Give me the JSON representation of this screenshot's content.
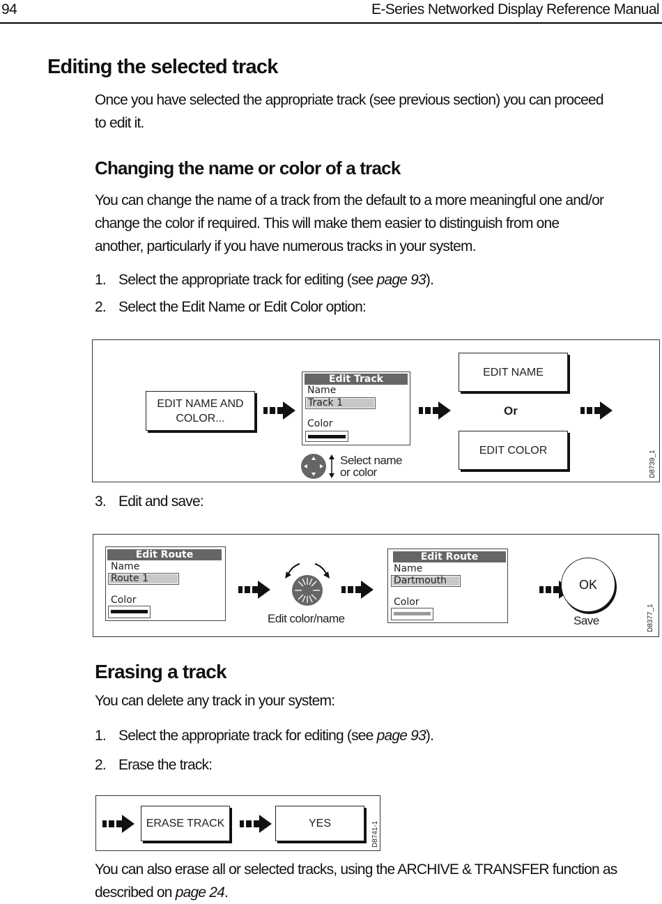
{
  "header": {
    "page_number": "94",
    "manual_title": "E-Series Networked Display Reference Manual"
  },
  "section_editing": {
    "heading": "Editing the selected track",
    "intro_line1": "Once you have selected the appropriate track (see previous section) you can proceed",
    "intro_line2": "to edit it."
  },
  "section_change": {
    "heading": "Changing the name or color of a track",
    "para_line1": "You can change the name of a track from the default to a more meaningful one and/or",
    "para_line2": "change the color if required. This will make them easier to distinguish from one",
    "para_line3": "another, particularly if you have numerous tracks in your system.",
    "steps": [
      {
        "num": "1.",
        "text": "Select the appropriate track for editing (see ",
        "link": "page 93",
        "after": ")."
      },
      {
        "num": "2.",
        "text": "Select the Edit Name or Edit Color option:"
      },
      {
        "num": "3.",
        "text": "Edit and save:"
      }
    ]
  },
  "diagram1": {
    "softkey_edit_name_color_line1": "EDIT NAME AND",
    "softkey_edit_name_color_line2": "COLOR...",
    "dialog": {
      "title": "Edit Track",
      "name_label": "Name",
      "name_value": "Track 1",
      "color_label": "Color",
      "color_swatch": "#111111"
    },
    "trackpad_caption_line1": "Select name",
    "trackpad_caption_line2": "or color",
    "softkey_edit_name": "EDIT NAME",
    "or_label": "Or",
    "softkey_edit_color": "EDIT COLOR",
    "diagram_id": "D8739_1"
  },
  "diagram2": {
    "dialog_before": {
      "title": "Edit Route",
      "name_label": "Name",
      "name_value": "Route 1",
      "color_label": "Color",
      "color_swatch": "#111111"
    },
    "knob_caption": "Edit color/name",
    "dialog_after": {
      "title": "Edit Route",
      "name_label": "Name",
      "name_value": "Dartmouth",
      "color_label": "Color",
      "color_swatch": "#999999"
    },
    "ok_button": "OK",
    "ok_caption": "Save",
    "diagram_id": "D8377_1"
  },
  "section_erase": {
    "heading": "Erasing a track",
    "intro": "You can delete any track in your system:",
    "steps": [
      {
        "num": "1.",
        "text": "Select the appropriate track for editing (see ",
        "link": "page 93",
        "after": ")."
      },
      {
        "num": "2.",
        "text": "Erase the track:"
      }
    ],
    "closing_line1": "You can also erase all or selected tracks, using the ARCHIVE & TRANSFER function as",
    "closing_line2_pre": "described on ",
    "closing_line2_link": "page 24",
    "closing_line2_post": "."
  },
  "diagram3": {
    "softkey_erase_track": "ERASE TRACK",
    "softkey_yes": "YES",
    "diagram_id": "D8741-1"
  }
}
